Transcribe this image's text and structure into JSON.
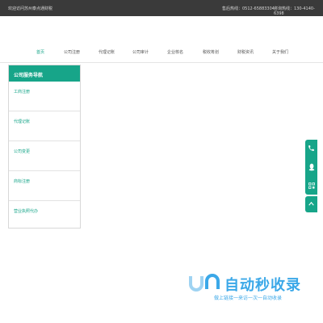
{
  "topbar": {
    "welcome": "欢迎访问苏州泰点通财税",
    "hotline": "售后热线：0512-65883304",
    "consult": "咨询热线：130-4140-6398"
  },
  "nav": {
    "items": [
      {
        "label": "首页",
        "active": true
      },
      {
        "label": "公司注册"
      },
      {
        "label": "代理记账"
      },
      {
        "label": "公司审计"
      },
      {
        "label": "企业核名"
      },
      {
        "label": "税收筹划"
      },
      {
        "label": "财税资讯"
      },
      {
        "label": "关于我们"
      }
    ]
  },
  "sidebar": {
    "title": "公司服务导航",
    "items": [
      {
        "label": "工商注册"
      },
      {
        "label": "代理记账"
      },
      {
        "label": "公司变更"
      },
      {
        "label": "商标注册"
      },
      {
        "label": "营业执照代办"
      }
    ]
  },
  "float_bar": {
    "icons": [
      "phone-icon",
      "qq-icon",
      "qrcode-icon"
    ],
    "top_icon": "chevron-up-icon"
  },
  "watermark": {
    "title": "自动秒收录",
    "subtitle": "做上链接一来访一次一自动收录"
  },
  "colors": {
    "accent": "#17a589",
    "topbar_bg": "#3a3a3a",
    "watermark": "#3ba8e8"
  }
}
